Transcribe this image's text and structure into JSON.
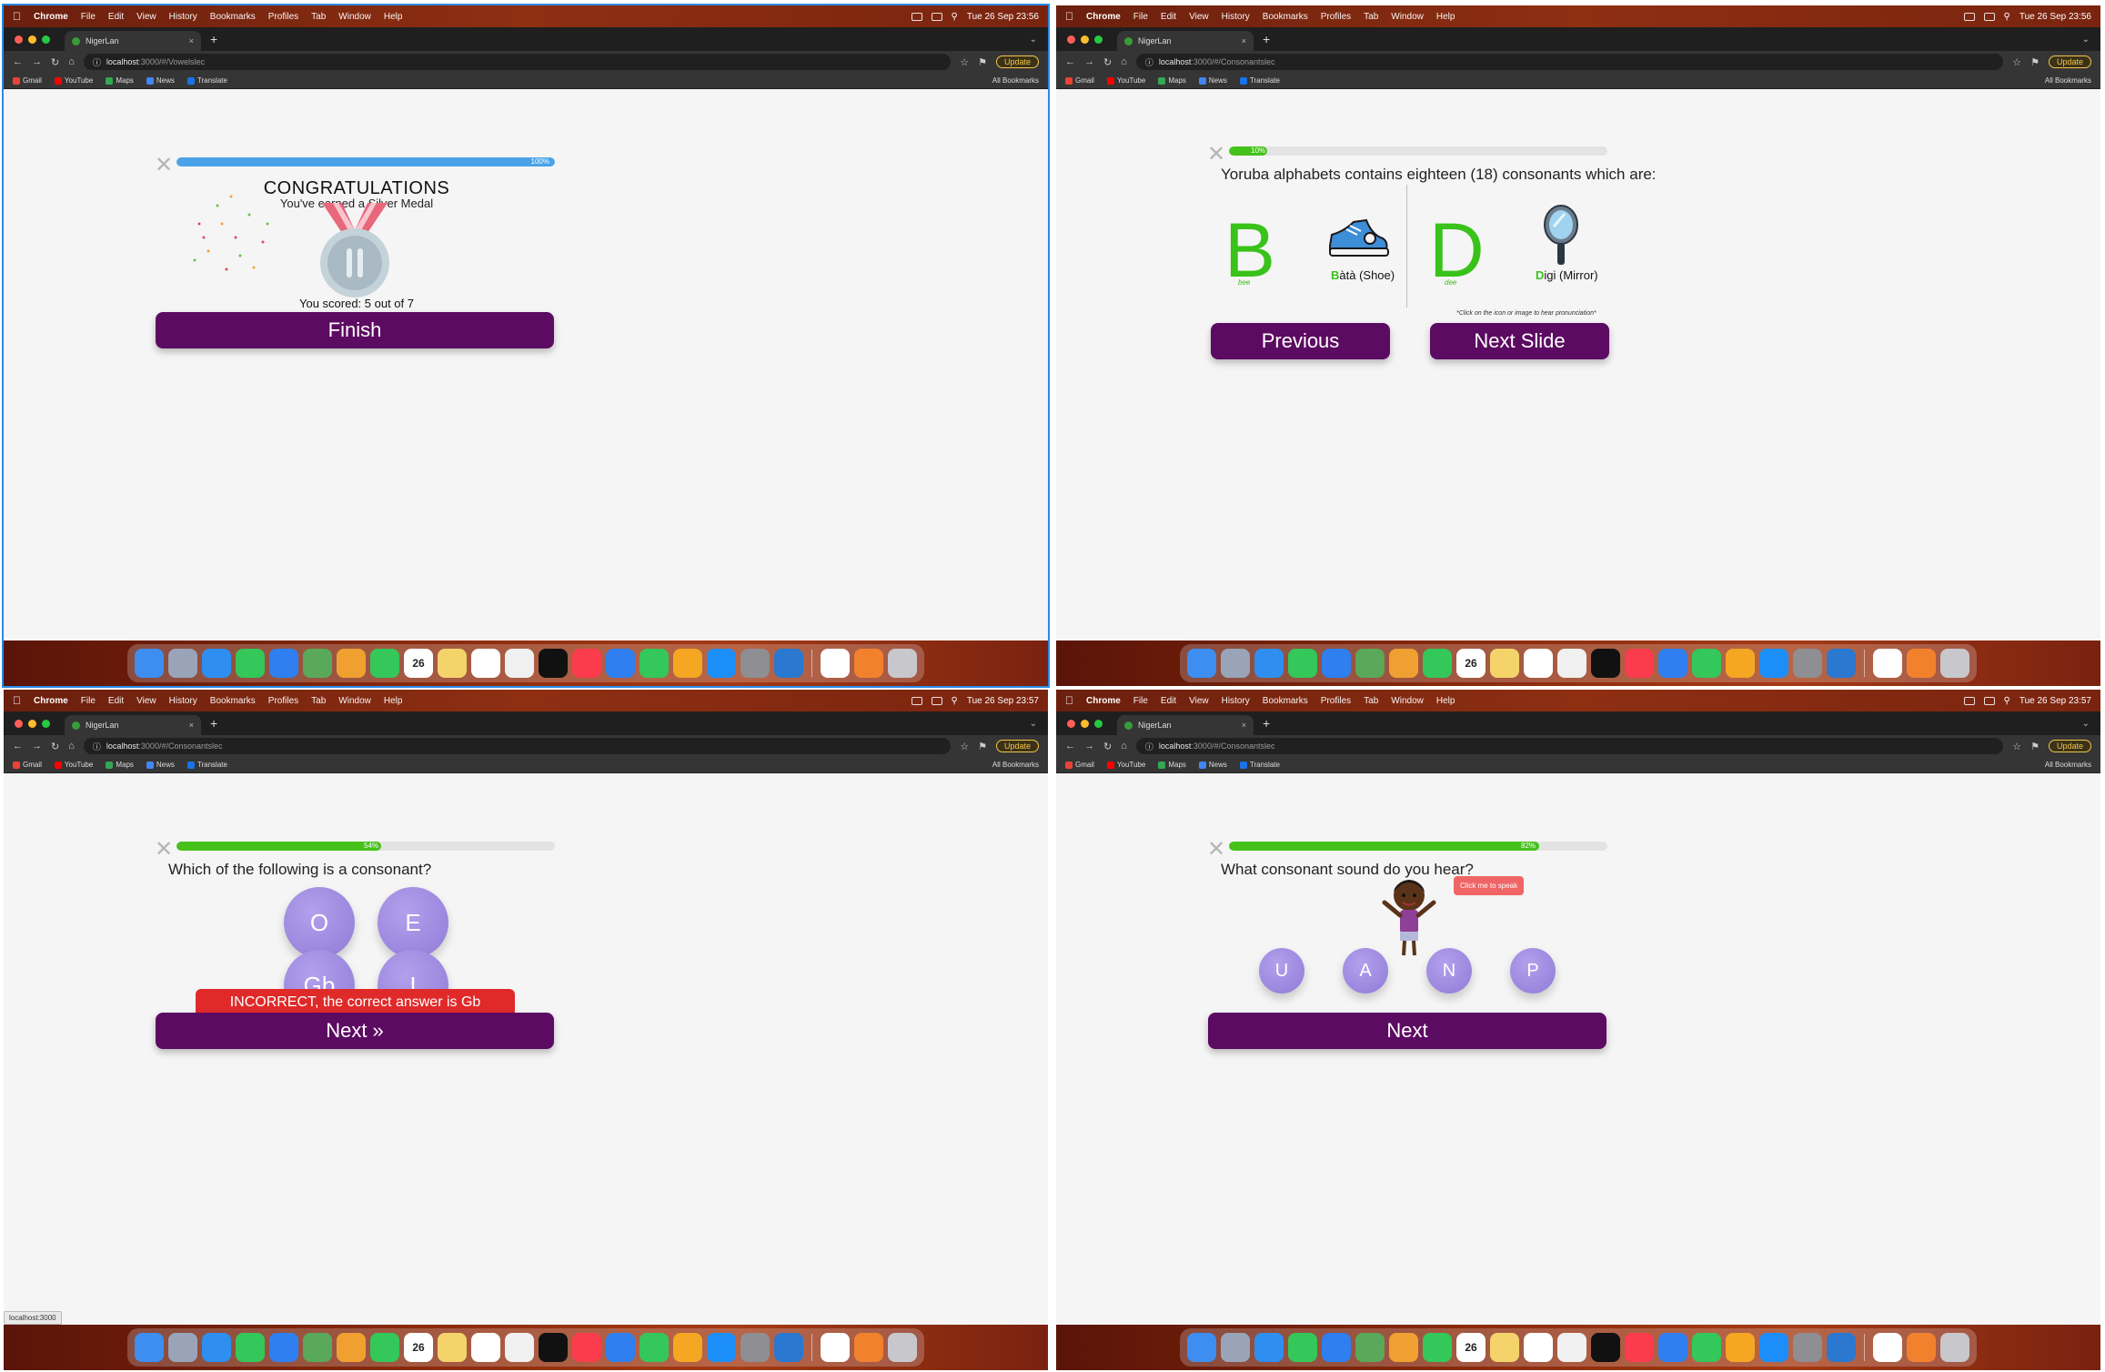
{
  "menubar": {
    "app": "Chrome",
    "items": [
      "File",
      "Edit",
      "View",
      "History",
      "Bookmarks",
      "Profiles",
      "Tab",
      "Window",
      "Help"
    ]
  },
  "browser": {
    "tab_title": "NigerLan",
    "url_host": "localhost",
    "update_label": "Update",
    "bookmarks": [
      "Gmail",
      "YouTube",
      "Maps",
      "News",
      "Translate"
    ],
    "all_bookmarks": "All Bookmarks"
  },
  "colors": {
    "accent_purple": "#5c0b62",
    "blue_progress": "#4aa3e8",
    "green_progress": "#44c21a",
    "bubble": "#9a86dd",
    "error_red": "#e02a2a"
  },
  "panels": [
    {
      "clock": "Tue 26 Sep  23:56",
      "url_path": ":3000/#/Vowelslec",
      "progress_pct": "100%",
      "progress_value": 1.0,
      "title": "CONGRATULATIONS",
      "subtitle": "You've earned a Silver Medal",
      "score": "You scored: 5 out of 7",
      "button": "Finish"
    },
    {
      "clock": "Tue 26 Sep  23:56",
      "url_path": ":3000/#/Consonantslec",
      "progress_pct": "10%",
      "progress_value": 0.1,
      "intro": "Yoruba alphabets contains eighteen (18) consonants which are:",
      "letters": [
        {
          "letter": "B",
          "sound": "bee",
          "word_first": "B",
          "word_rest": "àtà (Shoe)"
        },
        {
          "letter": "D",
          "sound": "dee",
          "word_first": "D",
          "word_rest": "igi (Mirror)"
        }
      ],
      "hint": "*Click on the icon or image to hear pronunciation*",
      "prev_button": "Previous",
      "next_button": "Next Slide"
    },
    {
      "clock": "Tue 26 Sep  23:57",
      "url_path": ":3000/#/Consonantslec",
      "progress_pct": "54%",
      "progress_value": 0.54,
      "question": "Which of the following is a consonant?",
      "options": [
        "O",
        "E",
        "Gb",
        "I"
      ],
      "feedback": "INCORRECT, the correct answer is Gb",
      "button": "Next »",
      "status_url": "localhost:3000"
    },
    {
      "clock": "Tue 26 Sep  23:57",
      "url_path": ":3000/#/Consonantslec",
      "progress_pct": "82%",
      "progress_value": 0.82,
      "question": "What consonant sound do you hear?",
      "speech_bubble": "Click me to speak",
      "options": [
        "U",
        "A",
        "N",
        "P"
      ],
      "button": "Next"
    }
  ],
  "dock_icons": [
    "finder-icon",
    "launchpad-icon",
    "safari-icon",
    "messages-icon",
    "mail-icon",
    "maps-icon",
    "photos-icon",
    "facetime-icon",
    "calendar-icon",
    "notes-icon",
    "reminders-icon",
    "freeform-icon",
    "tv-icon",
    "music-icon",
    "keynote-icon",
    "numbers-icon",
    "pages-icon",
    "appstore-icon",
    "settings-icon",
    "vscode-icon",
    "chrome-icon",
    "pen-icon",
    "trash-icon"
  ],
  "calendar_day": "26"
}
